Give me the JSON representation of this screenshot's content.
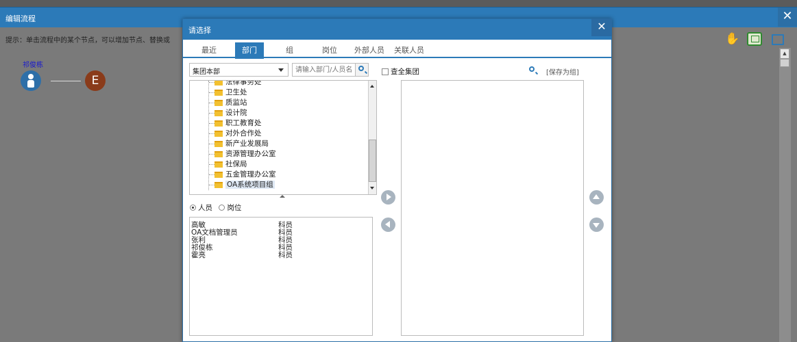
{
  "background": {
    "title": "编辑流程",
    "hint": "提示：单击流程中的某个节点，可以增加节点、替换或",
    "flow_person": "祁俊栋",
    "flow_end_letter": "E",
    "close_glyph": "✕",
    "hand_glyph": "✋"
  },
  "dialog": {
    "title": "请选择",
    "close_glyph": "✕",
    "tabs": [
      {
        "label": "最近"
      },
      {
        "label": "部门"
      },
      {
        "label": "组"
      },
      {
        "label": "岗位"
      },
      {
        "label": "外部人员"
      },
      {
        "label": "关联人员"
      }
    ],
    "active_tab": "部门",
    "org_select": "集团本部",
    "search_placeholder": "请输入部门/人员名",
    "tree_items": [
      {
        "label": "法律事务处"
      },
      {
        "label": "卫生处"
      },
      {
        "label": "质监站"
      },
      {
        "label": "设计院"
      },
      {
        "label": "职工教育处"
      },
      {
        "label": "对外合作处"
      },
      {
        "label": "新产业发展局"
      },
      {
        "label": "资源管理办公室"
      },
      {
        "label": "社保局"
      },
      {
        "label": "五金管理办公室"
      },
      {
        "label": "OA系统项目组"
      }
    ],
    "selected_tree_item": "OA系统项目组",
    "radio_options": [
      {
        "label": "人员",
        "checked": true
      },
      {
        "label": "岗位",
        "checked": false
      }
    ],
    "people": [
      {
        "name": "高敏",
        "role": "科员"
      },
      {
        "name": "OA文档管理员",
        "role": "科员"
      },
      {
        "name": "张利",
        "role": "科员"
      },
      {
        "name": "祁俊栋",
        "role": "科员"
      },
      {
        "name": "霍亮",
        "role": "科员"
      }
    ],
    "check_all_group": "查全集团",
    "save_as_group": "[保存为组]"
  },
  "colors": {
    "accent": "#2c7ab8",
    "folder": "#f2c030",
    "circle_button": "#a8b4bf"
  }
}
